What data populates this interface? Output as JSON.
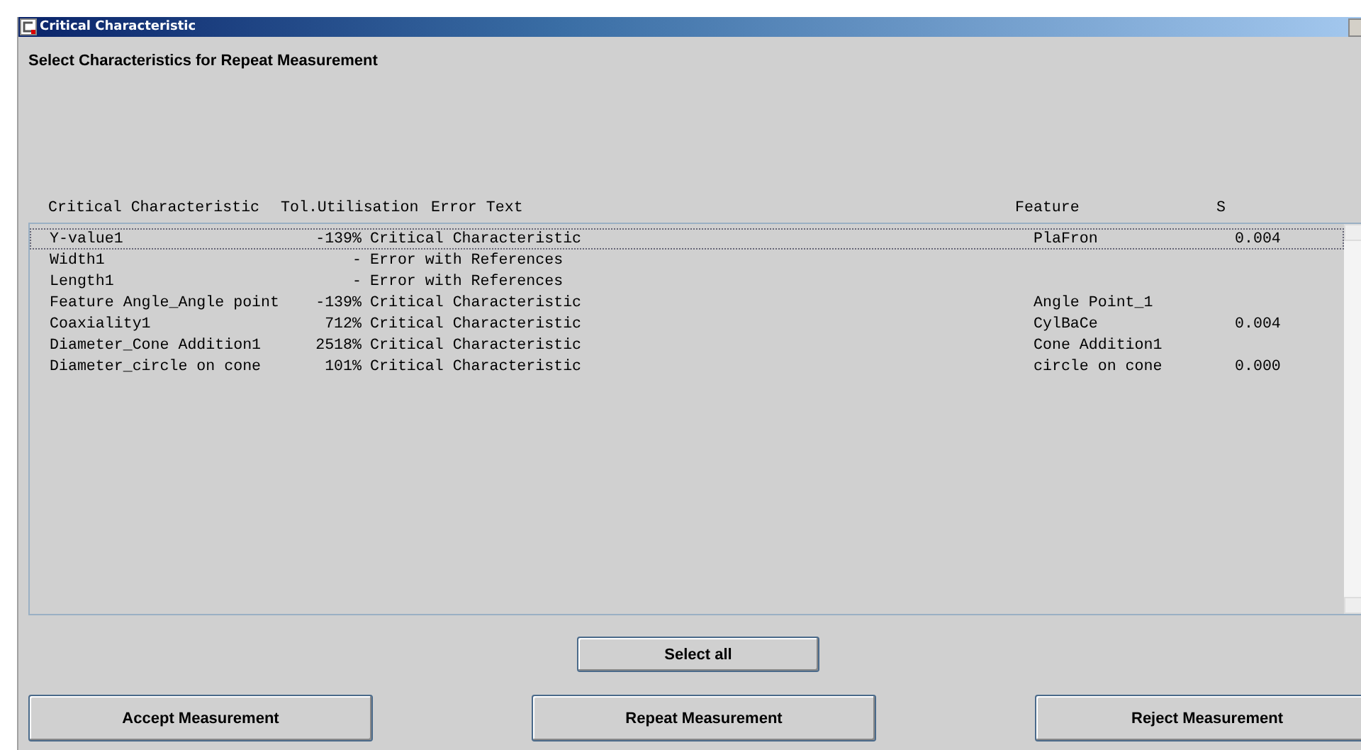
{
  "window": {
    "title": "Critical Characteristic"
  },
  "heading": "Select Characteristics for Repeat Measurement",
  "table": {
    "columns": [
      "Critical Characteristic",
      "Tol.Utilisation",
      "Error Text",
      "Feature",
      "S"
    ],
    "rows": [
      {
        "name": "Y-value1",
        "tol": "-139%",
        "error": "Critical Characteristic",
        "feature": "PlaFron",
        "s": "0.004",
        "selected": true
      },
      {
        "name": "Width1",
        "tol": "-",
        "error": "Error with References",
        "selected": false
      },
      {
        "name": "Length1",
        "tol": "-",
        "error": "Error with References",
        "selected": false
      },
      {
        "name": "Feature Angle_Angle point",
        "tol": "-139%",
        "error": "Critical Characteristic",
        "feature": "Angle Point_1",
        "selected": false
      },
      {
        "name": "Coaxiality1",
        "tol": "712%",
        "error": "Critical Characteristic",
        "feature": "CylBaCe",
        "s": "0.004",
        "selected": false
      },
      {
        "name": "Diameter_Cone Addition1",
        "tol": "2518%",
        "error": "Critical Characteristic",
        "feature": "Cone Addition1",
        "selected": false
      },
      {
        "name": "Diameter_circle on cone",
        "tol": "101%",
        "error": "Critical Characteristic",
        "feature": "circle on cone",
        "s": "0.000",
        "selected": false
      }
    ]
  },
  "select_all": "Select all",
  "buttons": [
    "Accept Measurement",
    "Repeat Measurement",
    "Reject Measurement"
  ]
}
